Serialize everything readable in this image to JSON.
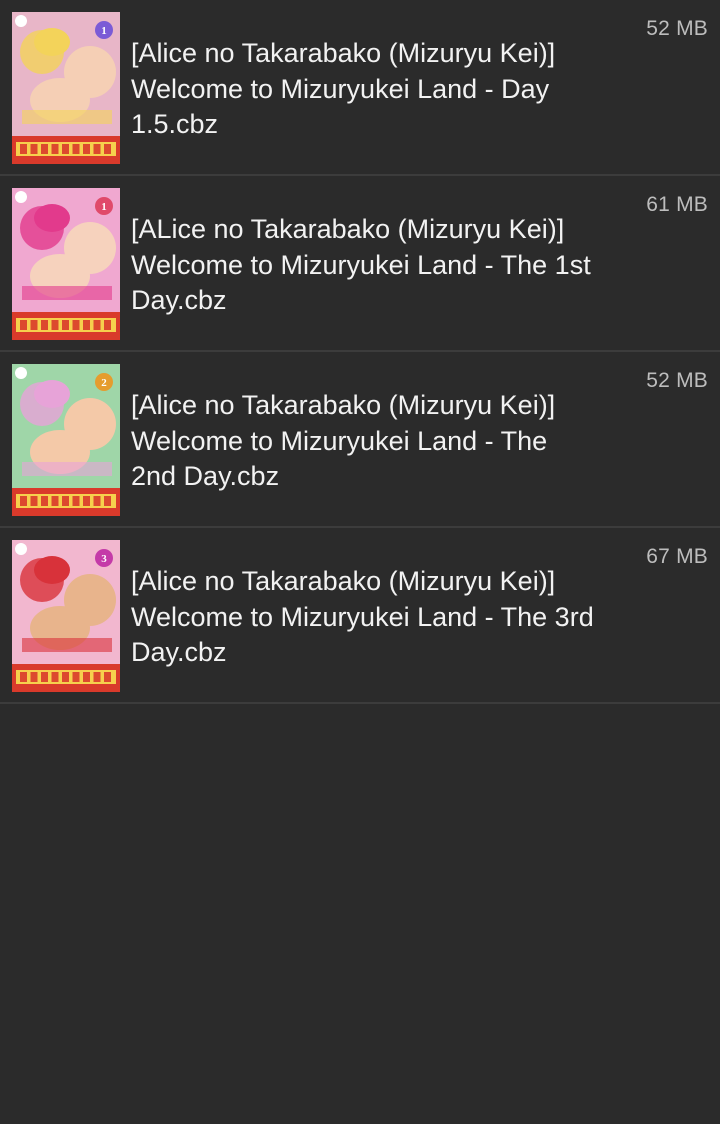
{
  "files": [
    {
      "name": "[Alice no Takarabako (Mizuryu Kei)]\nWelcome to Mizuryukei Land - Day\n1.5.cbz",
      "size": "52 MB",
      "cover_badge": "1",
      "colors": {
        "bg": "#e8b6c8",
        "accent": "#f3d35a",
        "skin": "#f5cfb5",
        "badge": "#7b5bd6",
        "logo": "#d93a2b"
      }
    },
    {
      "name": "[ALice no Takarabako (Mizuryu Kei)]\nWelcome to Mizuryukei Land - The 1st\nDay.cbz",
      "size": "61 MB",
      "cover_badge": "1",
      "colors": {
        "bg": "#f0a8d0",
        "accent": "#e23a8c",
        "skin": "#f6d2bd",
        "badge": "#e04a6a",
        "logo": "#d93a2b"
      }
    },
    {
      "name": "[Alice no Takarabako (Mizuryu Kei)]\nWelcome to Mizuryukei Land - The\n2nd Day.cbz",
      "size": "52 MB",
      "cover_badge": "2",
      "colors": {
        "bg": "#9fd6a8",
        "accent": "#e7a3d8",
        "skin": "#f4c9a8",
        "badge": "#e59c2e",
        "logo": "#d93a2b"
      }
    },
    {
      "name": "[Alice no Takarabako (Mizuryu Kei)]\nWelcome to Mizuryukei Land - The 3rd\nDay.cbz",
      "size": "67 MB",
      "cover_badge": "3",
      "colors": {
        "bg": "#f2b7cf",
        "accent": "#d8323a",
        "skin": "#e8b48c",
        "badge": "#c43aa8",
        "logo": "#d93a2b"
      }
    }
  ]
}
